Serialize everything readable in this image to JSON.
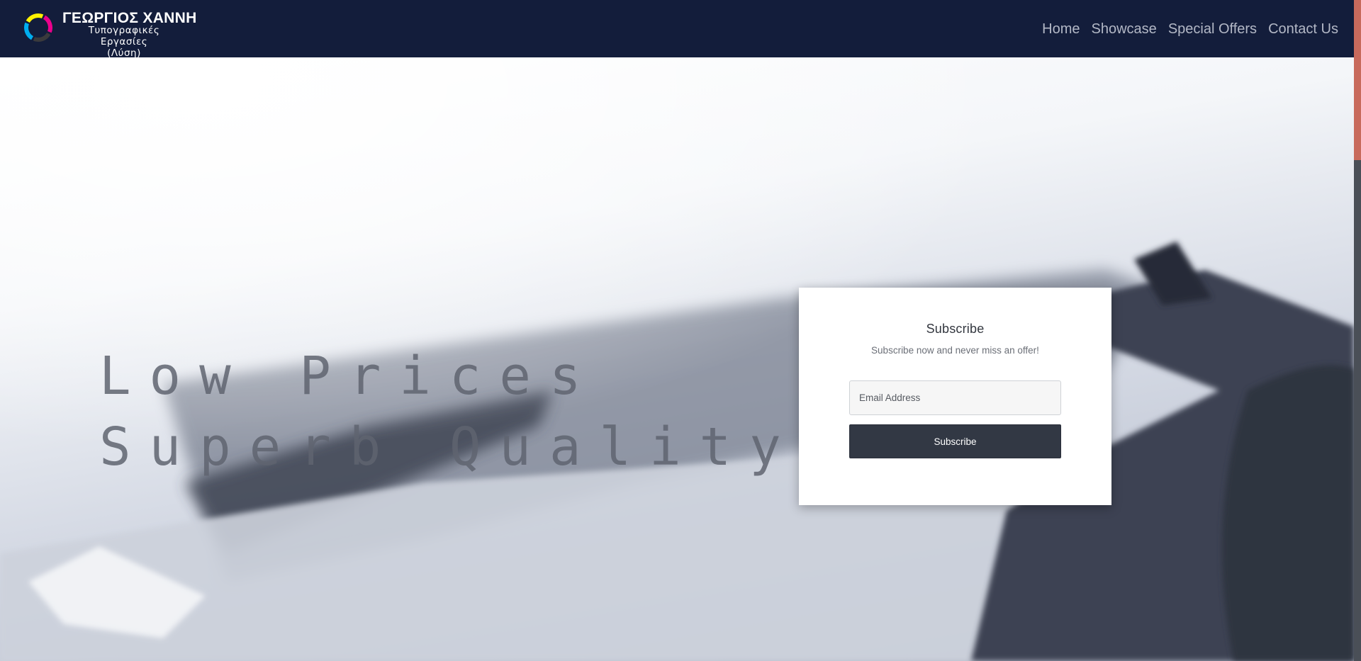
{
  "brand": {
    "title": "ΓΕΩΡΓΙΟΣ ΧΑΝΝΗ",
    "subtitle_line1": "Τυπογραφικές Εργασίες",
    "subtitle_line2": "(Λύση)",
    "logo_icon": "cmyk-ring-logo-icon",
    "logo_colors": [
      "#ec008c",
      "#fff200",
      "#00aeef",
      "#231f20"
    ]
  },
  "nav": {
    "items": [
      {
        "label": "Home"
      },
      {
        "label": "Showcase"
      },
      {
        "label": "Special Offers"
      },
      {
        "label": "Contact Us"
      }
    ]
  },
  "hero": {
    "headline_line1": "Low Prices",
    "headline_line2": "Superb Quality"
  },
  "subscribe": {
    "title": "Subscribe",
    "text": "Subscribe now and never miss an offer!",
    "email_placeholder": "Email Address",
    "email_value": "",
    "button_label": "Subscribe"
  },
  "colors": {
    "navbar_bg": "#131d3b",
    "nav_link": "#b3b8c6",
    "button_bg": "#323844",
    "scrollbar_thumb": "#c86a5c"
  }
}
